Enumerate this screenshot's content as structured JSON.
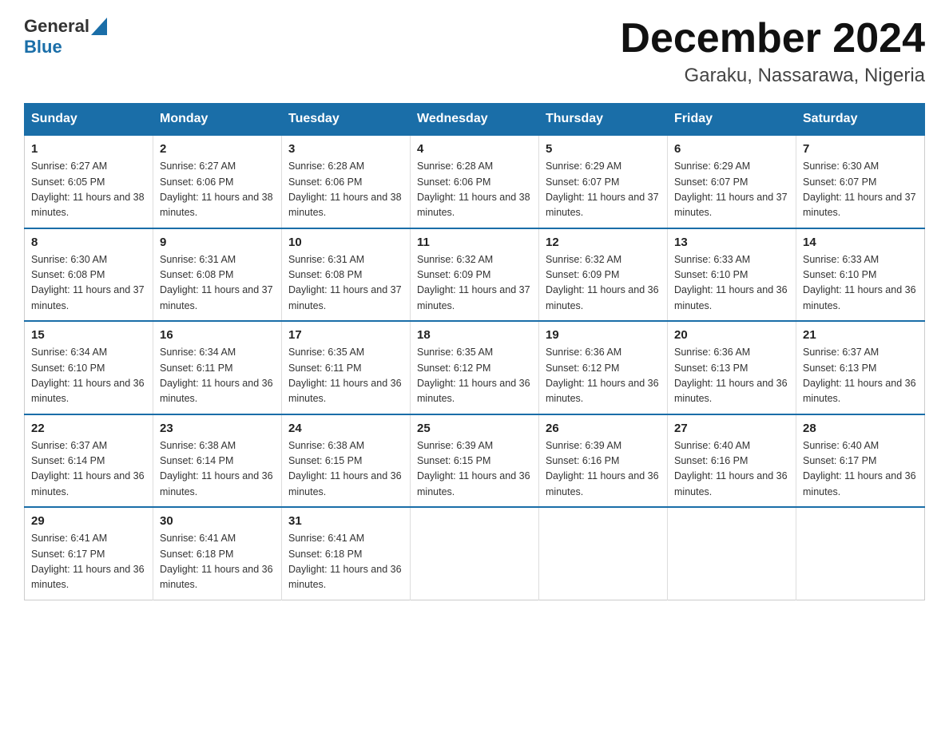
{
  "logo": {
    "general": "General",
    "blue": "Blue"
  },
  "title": "December 2024",
  "subtitle": "Garaku, Nassarawa, Nigeria",
  "days_of_week": [
    "Sunday",
    "Monday",
    "Tuesday",
    "Wednesday",
    "Thursday",
    "Friday",
    "Saturday"
  ],
  "weeks": [
    [
      {
        "day": "1",
        "sunrise": "6:27 AM",
        "sunset": "6:05 PM",
        "daylight": "11 hours and 38 minutes."
      },
      {
        "day": "2",
        "sunrise": "6:27 AM",
        "sunset": "6:06 PM",
        "daylight": "11 hours and 38 minutes."
      },
      {
        "day": "3",
        "sunrise": "6:28 AM",
        "sunset": "6:06 PM",
        "daylight": "11 hours and 38 minutes."
      },
      {
        "day": "4",
        "sunrise": "6:28 AM",
        "sunset": "6:06 PM",
        "daylight": "11 hours and 38 minutes."
      },
      {
        "day": "5",
        "sunrise": "6:29 AM",
        "sunset": "6:07 PM",
        "daylight": "11 hours and 37 minutes."
      },
      {
        "day": "6",
        "sunrise": "6:29 AM",
        "sunset": "6:07 PM",
        "daylight": "11 hours and 37 minutes."
      },
      {
        "day": "7",
        "sunrise": "6:30 AM",
        "sunset": "6:07 PM",
        "daylight": "11 hours and 37 minutes."
      }
    ],
    [
      {
        "day": "8",
        "sunrise": "6:30 AM",
        "sunset": "6:08 PM",
        "daylight": "11 hours and 37 minutes."
      },
      {
        "day": "9",
        "sunrise": "6:31 AM",
        "sunset": "6:08 PM",
        "daylight": "11 hours and 37 minutes."
      },
      {
        "day": "10",
        "sunrise": "6:31 AM",
        "sunset": "6:08 PM",
        "daylight": "11 hours and 37 minutes."
      },
      {
        "day": "11",
        "sunrise": "6:32 AM",
        "sunset": "6:09 PM",
        "daylight": "11 hours and 37 minutes."
      },
      {
        "day": "12",
        "sunrise": "6:32 AM",
        "sunset": "6:09 PM",
        "daylight": "11 hours and 36 minutes."
      },
      {
        "day": "13",
        "sunrise": "6:33 AM",
        "sunset": "6:10 PM",
        "daylight": "11 hours and 36 minutes."
      },
      {
        "day": "14",
        "sunrise": "6:33 AM",
        "sunset": "6:10 PM",
        "daylight": "11 hours and 36 minutes."
      }
    ],
    [
      {
        "day": "15",
        "sunrise": "6:34 AM",
        "sunset": "6:10 PM",
        "daylight": "11 hours and 36 minutes."
      },
      {
        "day": "16",
        "sunrise": "6:34 AM",
        "sunset": "6:11 PM",
        "daylight": "11 hours and 36 minutes."
      },
      {
        "day": "17",
        "sunrise": "6:35 AM",
        "sunset": "6:11 PM",
        "daylight": "11 hours and 36 minutes."
      },
      {
        "day": "18",
        "sunrise": "6:35 AM",
        "sunset": "6:12 PM",
        "daylight": "11 hours and 36 minutes."
      },
      {
        "day": "19",
        "sunrise": "6:36 AM",
        "sunset": "6:12 PM",
        "daylight": "11 hours and 36 minutes."
      },
      {
        "day": "20",
        "sunrise": "6:36 AM",
        "sunset": "6:13 PM",
        "daylight": "11 hours and 36 minutes."
      },
      {
        "day": "21",
        "sunrise": "6:37 AM",
        "sunset": "6:13 PM",
        "daylight": "11 hours and 36 minutes."
      }
    ],
    [
      {
        "day": "22",
        "sunrise": "6:37 AM",
        "sunset": "6:14 PM",
        "daylight": "11 hours and 36 minutes."
      },
      {
        "day": "23",
        "sunrise": "6:38 AM",
        "sunset": "6:14 PM",
        "daylight": "11 hours and 36 minutes."
      },
      {
        "day": "24",
        "sunrise": "6:38 AM",
        "sunset": "6:15 PM",
        "daylight": "11 hours and 36 minutes."
      },
      {
        "day": "25",
        "sunrise": "6:39 AM",
        "sunset": "6:15 PM",
        "daylight": "11 hours and 36 minutes."
      },
      {
        "day": "26",
        "sunrise": "6:39 AM",
        "sunset": "6:16 PM",
        "daylight": "11 hours and 36 minutes."
      },
      {
        "day": "27",
        "sunrise": "6:40 AM",
        "sunset": "6:16 PM",
        "daylight": "11 hours and 36 minutes."
      },
      {
        "day": "28",
        "sunrise": "6:40 AM",
        "sunset": "6:17 PM",
        "daylight": "11 hours and 36 minutes."
      }
    ],
    [
      {
        "day": "29",
        "sunrise": "6:41 AM",
        "sunset": "6:17 PM",
        "daylight": "11 hours and 36 minutes."
      },
      {
        "day": "30",
        "sunrise": "6:41 AM",
        "sunset": "6:18 PM",
        "daylight": "11 hours and 36 minutes."
      },
      {
        "day": "31",
        "sunrise": "6:41 AM",
        "sunset": "6:18 PM",
        "daylight": "11 hours and 36 minutes."
      },
      null,
      null,
      null,
      null
    ]
  ]
}
